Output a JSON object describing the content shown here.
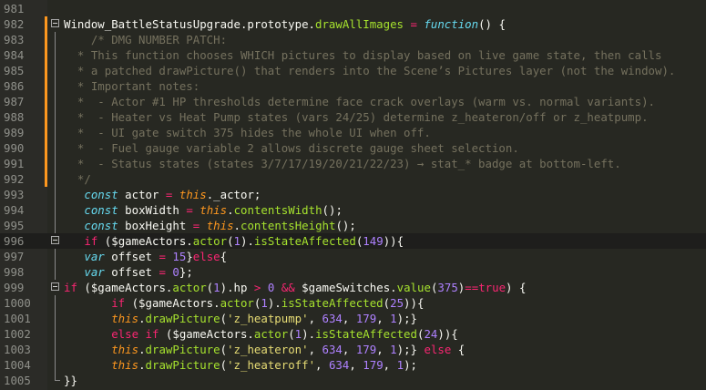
{
  "editor": {
    "lines": [
      {
        "num": "981",
        "text": ""
      },
      {
        "num": "982",
        "text": "Window_BattleStatusUpgrade.prototype.drawAllImages = function() {"
      },
      {
        "num": "983",
        "text": "    /* DMG NUMBER PATCH:"
      },
      {
        "num": "984",
        "text": "  * This function chooses WHICH pictures to display based on live game state, then calls"
      },
      {
        "num": "985",
        "text": "  * a patched drawPicture() that renders into the Scene’s Pictures layer (not the window)."
      },
      {
        "num": "986",
        "text": "  * Important notes:"
      },
      {
        "num": "987",
        "text": "  *  - Actor #1 HP thresholds determine face crack overlays (warm vs. normal variants)."
      },
      {
        "num": "988",
        "text": "  *  - Heater vs Heat Pump states (vars 24/25) determine z_heateron/off or z_heatpump."
      },
      {
        "num": "989",
        "text": "  *  - UI gate switch 375 hides the whole UI when off."
      },
      {
        "num": "990",
        "text": "  *  - Fuel gauge variable 2 allows discrete gauge sheet selection."
      },
      {
        "num": "991",
        "text": "  *  - Status states (states 3/7/17/19/20/21/22/23) → stat_* badge at bottom-left."
      },
      {
        "num": "992",
        "text": "  */"
      },
      {
        "num": "993",
        "text": "   const actor = this._actor;"
      },
      {
        "num": "994",
        "text": "   const boxWidth = this.contentsWidth();"
      },
      {
        "num": "995",
        "text": "   const boxHeight = this.contentsHeight();"
      },
      {
        "num": "996",
        "text": "   if ($gameActors.actor(1).isStateAffected(149)){"
      },
      {
        "num": "997",
        "text": "   var offset = 15}else{"
      },
      {
        "num": "998",
        "text": "   var offset = 0};"
      },
      {
        "num": "999",
        "text": "if ($gameActors.actor(1).hp > 0 && $gameSwitches.value(375)==true) {"
      },
      {
        "num": "1000",
        "text": "       if ($gameActors.actor(1).isStateAffected(25)){"
      },
      {
        "num": "1001",
        "text": "       this.drawPicture('z_heatpump', 634, 179, 1);}"
      },
      {
        "num": "1002",
        "text": "       else if ($gameActors.actor(1).isStateAffected(24)){"
      },
      {
        "num": "1003",
        "text": "       this.drawPicture('z_heateron', 634, 179, 1);} else {"
      },
      {
        "num": "1004",
        "text": "       this.drawPicture('z_heateroff', 634, 179, 1);"
      },
      {
        "num": "1005",
        "text": "}}"
      }
    ],
    "colors": {
      "background": "#272822",
      "gutter": "#2b2b27",
      "current_line": "#1e1e1c",
      "modified_marker": "#fd971f",
      "comment": "#75715e",
      "storage_keyword": "#66d9ef",
      "keyword": "#f92672",
      "function": "#a6e22e",
      "number": "#ae81ff",
      "string": "#e6db74",
      "this_keyword": "#fd971f",
      "line_number": "#8f908a"
    }
  }
}
